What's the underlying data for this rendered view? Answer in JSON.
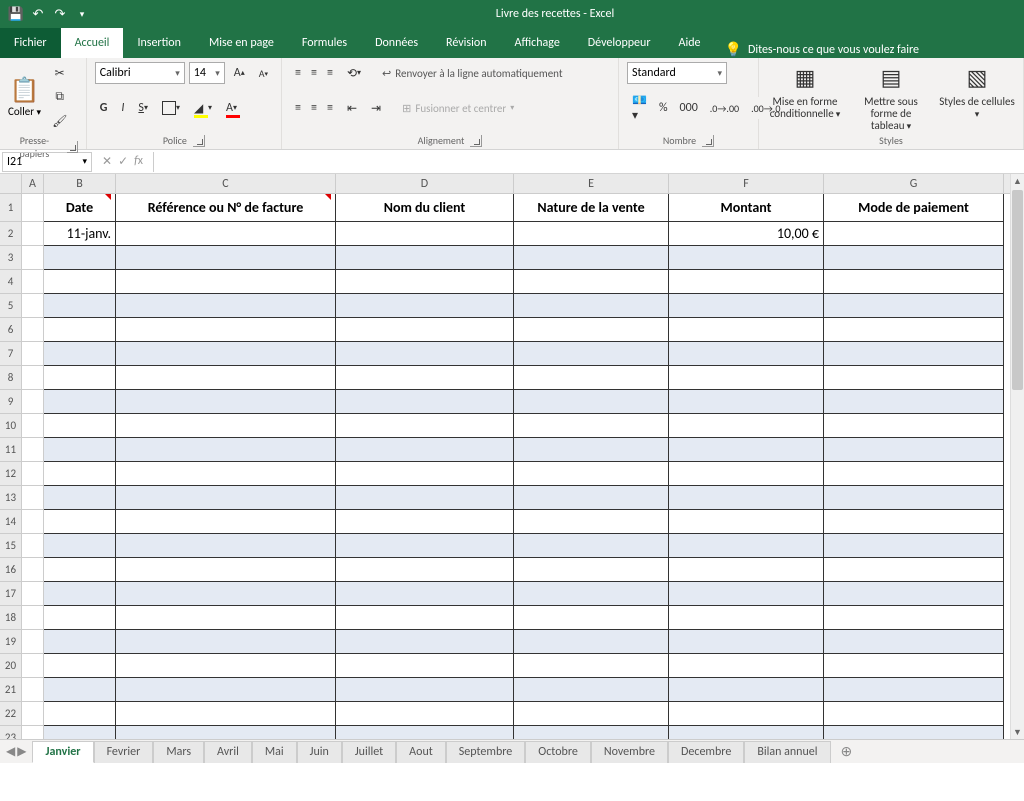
{
  "app": {
    "doc_title": "Livre des recettes",
    "app_name": "Excel",
    "sep": "  -  "
  },
  "qat": {
    "save": "save",
    "undo": "undo",
    "redo": "redo"
  },
  "tabs": {
    "file": "Fichier",
    "home": "Accueil",
    "insert": "Insertion",
    "pagelayout": "Mise en page",
    "formulas": "Formules",
    "data": "Données",
    "review": "Révision",
    "view": "Affichage",
    "developer": "Développeur",
    "help": "Aide",
    "tellme": "Dites-nous ce que vous voulez faire"
  },
  "ribbon": {
    "clipboard": {
      "paste": "Coller",
      "group": "Presse-papiers"
    },
    "font": {
      "name": "Calibri",
      "size": "14",
      "bold": "G",
      "italic": "I",
      "underline": "S",
      "group": "Police"
    },
    "alignment": {
      "wrap": "Renvoyer à la ligne automatiquement",
      "merge": "Fusionner et centrer",
      "group": "Alignement"
    },
    "number": {
      "format": "Standard",
      "group": "Nombre"
    },
    "styles": {
      "cond": "Mise en forme conditionnelle",
      "table": "Mettre sous forme de tableau",
      "cell": "Styles de cellules",
      "group": "Styles"
    }
  },
  "namebox": "I21",
  "columns": [
    "A",
    "B",
    "C",
    "D",
    "E",
    "F",
    "G"
  ],
  "headers": {
    "B": "Date",
    "C": "Référence ou N° de facture",
    "D": "Nom du client",
    "E": "Nature de la vente",
    "F": "Montant",
    "G": "Mode de paiement"
  },
  "row2": {
    "B": "11-janv.",
    "F": "10,00 €"
  },
  "sheets": [
    "Janvier",
    "Fevrier",
    "Mars",
    "Avril",
    "Mai",
    "Juin",
    "Juillet",
    "Aout",
    "Septembre",
    "Octobre",
    "Novembre",
    "Decembre",
    "Bilan annuel"
  ],
  "active_sheet": "Janvier"
}
